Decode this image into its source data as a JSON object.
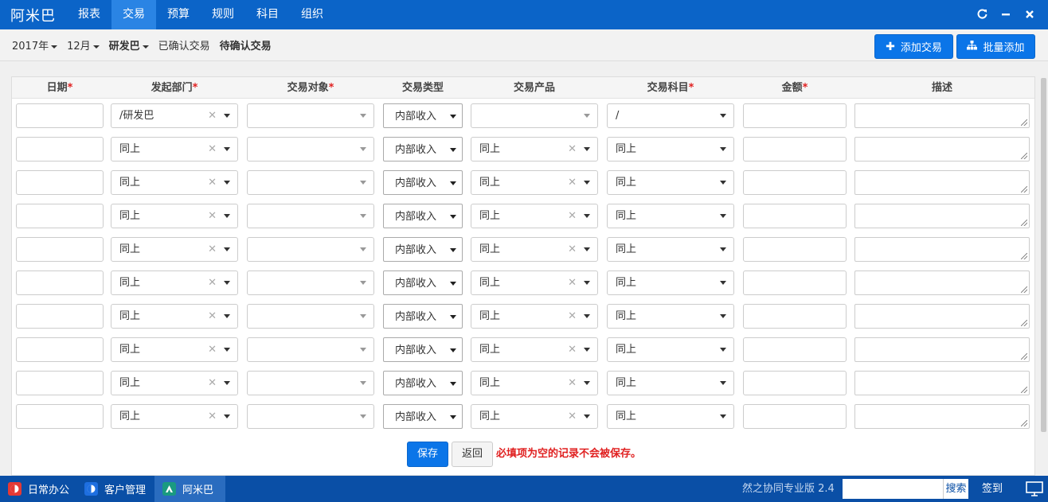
{
  "app": {
    "brand": "阿米巴"
  },
  "nav": [
    "报表",
    "交易",
    "预算",
    "规则",
    "科目",
    "组织"
  ],
  "nav_active": "交易",
  "window_controls": [
    "refresh-icon",
    "minimize-icon",
    "close-icon"
  ],
  "filters": {
    "year": "2017年",
    "month": "12月",
    "dept": "研发巴",
    "confirmed": "已确认交易",
    "pending": "待确认交易"
  },
  "buttons": {
    "add": "添加交易",
    "batch_add": "批量添加",
    "save": "保存",
    "back": "返回"
  },
  "table": {
    "headers": [
      "日期",
      "发起部门",
      "交易对象",
      "交易类型",
      "交易产品",
      "交易科目",
      "金额",
      "描述"
    ],
    "required_mark": "*",
    "required": [
      true,
      true,
      true,
      false,
      false,
      true,
      true,
      false
    ],
    "rows": [
      {
        "dept": "/研发巴",
        "type": "内部收入",
        "product": "",
        "subject": "/"
      },
      {
        "dept": "同上",
        "type": "内部收入",
        "product": "同上",
        "subject": "同上"
      },
      {
        "dept": "同上",
        "type": "内部收入",
        "product": "同上",
        "subject": "同上"
      },
      {
        "dept": "同上",
        "type": "内部收入",
        "product": "同上",
        "subject": "同上"
      },
      {
        "dept": "同上",
        "type": "内部收入",
        "product": "同上",
        "subject": "同上"
      },
      {
        "dept": "同上",
        "type": "内部收入",
        "product": "同上",
        "subject": "同上"
      },
      {
        "dept": "同上",
        "type": "内部收入",
        "product": "同上",
        "subject": "同上"
      },
      {
        "dept": "同上",
        "type": "内部收入",
        "product": "同上",
        "subject": "同上"
      },
      {
        "dept": "同上",
        "type": "内部收入",
        "product": "同上",
        "subject": "同上"
      },
      {
        "dept": "同上",
        "type": "内部收入",
        "product": "同上",
        "subject": "同上"
      }
    ]
  },
  "warning": "必填项为空的记录不会被保存。",
  "taskbar": {
    "tasks": [
      "日常办公",
      "客户管理",
      "阿米巴"
    ],
    "version": "然之协同专业版 2.4",
    "search_label": "搜索",
    "sign_in": "签到"
  },
  "colors": {
    "primary": "#0b64c8",
    "accent": "#0b75e8",
    "required": "#e02020",
    "taskbar": "#0a4fa6"
  }
}
